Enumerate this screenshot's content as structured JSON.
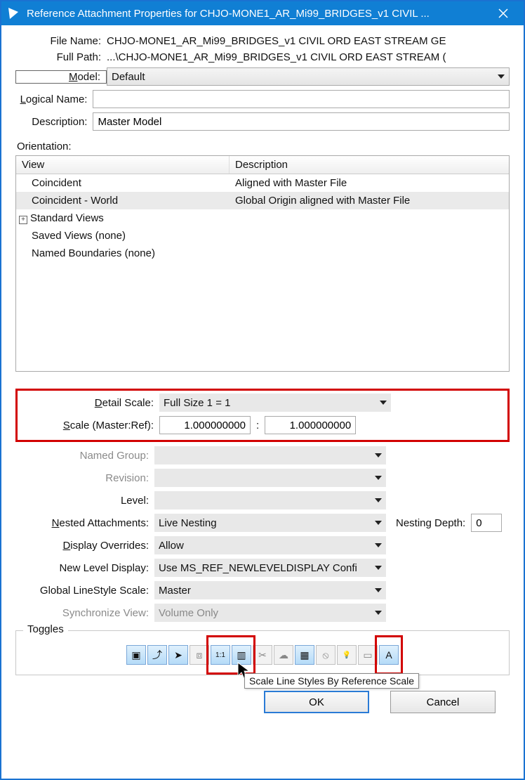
{
  "window": {
    "title": "Reference Attachment Properties for CHJO-MONE1_AR_Mi99_BRIDGES_v1 CIVIL ..."
  },
  "fields": {
    "file_name_label": "File Name:",
    "file_name_value": "CHJO-MONE1_AR_Mi99_BRIDGES_v1 CIVIL ORD EAST STREAM GE",
    "full_path_label": "Full Path:",
    "full_path_value": "...\\CHJO-MONE1_AR_Mi99_BRIDGES_v1 CIVIL ORD EAST STREAM (",
    "model_label": "Model:",
    "model_value": "Default",
    "logical_name_label": "Logical Name:",
    "logical_name_value": "",
    "description_label": "Description:",
    "description_value": "Master Model"
  },
  "orientation": {
    "label": "Orientation:",
    "header_view": "View",
    "header_desc": "Description",
    "rows": [
      {
        "view": "Coincident",
        "desc": "Aligned with Master File",
        "selected": false
      },
      {
        "view": "Coincident - World",
        "desc": "Global Origin aligned with Master File",
        "selected": true
      },
      {
        "view": "Standard Views",
        "desc": "",
        "expandable": true
      },
      {
        "view": "Saved Views (none)",
        "desc": ""
      },
      {
        "view": "Named Boundaries (none)",
        "desc": ""
      }
    ]
  },
  "props": {
    "detail_scale_label": "Detail Scale:",
    "detail_scale_value": "Full Size 1 = 1",
    "scale_label": "Scale (Master:Ref):",
    "scale_master": "1.000000000",
    "scale_sep": ":",
    "scale_ref": "1.000000000",
    "named_group_label": "Named Group:",
    "named_group_value": "",
    "revision_label": "Revision:",
    "revision_value": "",
    "level_label": "Level:",
    "level_value": "",
    "nested_label": "Nested Attachments:",
    "nested_value": "Live Nesting",
    "nesting_depth_label": "Nesting Depth:",
    "nesting_depth_value": "0",
    "display_overrides_label": "Display Overrides:",
    "display_overrides_value": "Allow",
    "new_level_label": "New Level Display:",
    "new_level_value": "Use MS_REF_NEWLEVELDISPLAY Confi",
    "global_linestyle_label": "Global LineStyle Scale:",
    "global_linestyle_value": "Master",
    "sync_view_label": "Synchronize View:",
    "sync_view_value": "Volume Only"
  },
  "toggles": {
    "legend": "Toggles",
    "tooltip": "Scale Line Styles By Reference Scale",
    "items": [
      {
        "name": "display-icon",
        "glyph": "▣",
        "on": true
      },
      {
        "name": "snap-icon",
        "glyph": "⤴",
        "on": true
      },
      {
        "name": "locate-icon",
        "glyph": "➤",
        "on": true
      },
      {
        "name": "clip-back-icon",
        "glyph": "⧈",
        "on": false
      },
      {
        "name": "true-scale-icon",
        "glyph": "1:1",
        "on": true
      },
      {
        "name": "line-styles-scale-icon",
        "glyph": "▥",
        "on": true
      },
      {
        "name": "clip-front-icon",
        "glyph": "✂",
        "on": false
      },
      {
        "name": "clip-mask-icon",
        "glyph": "☁",
        "on": false
      },
      {
        "name": "raster-ref-icon",
        "glyph": "▦",
        "on": true
      },
      {
        "name": "ignore-attach-icon",
        "glyph": "⦸",
        "on": false
      },
      {
        "name": "lights-icon",
        "glyph": "💡",
        "on": false
      },
      {
        "name": "drawing-boundary-icon",
        "glyph": "▭",
        "on": false
      },
      {
        "name": "annotation-scale-icon",
        "glyph": "A",
        "on": true
      }
    ]
  },
  "buttons": {
    "ok": "OK",
    "cancel": "Cancel"
  },
  "underline": {
    "M": "M",
    "L": "L",
    "D": "D",
    "S": "S",
    "N": "N"
  }
}
